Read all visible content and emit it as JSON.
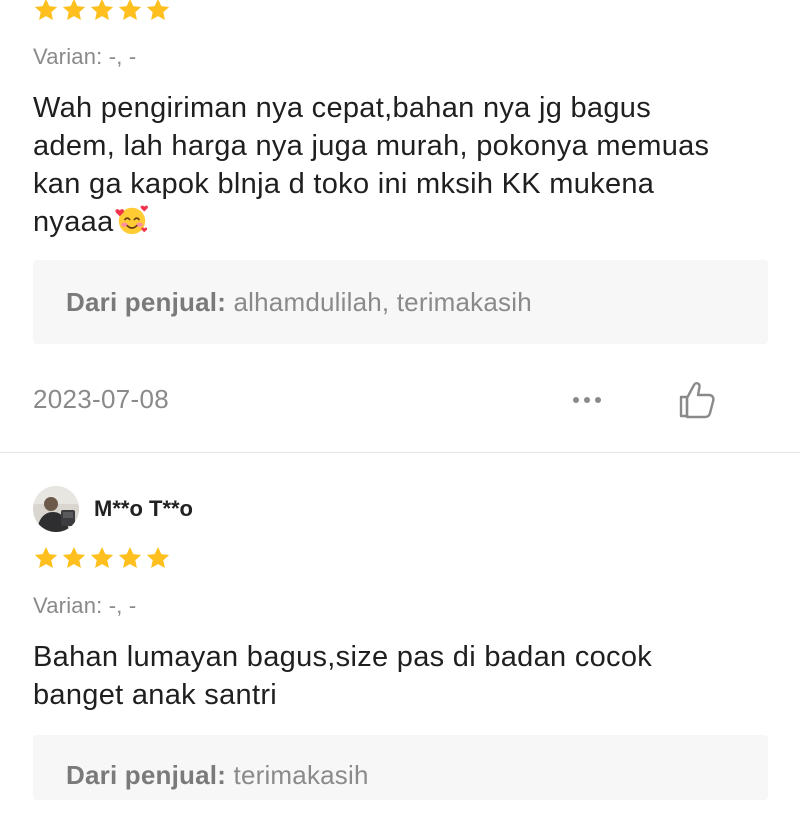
{
  "reviews": [
    {
      "rating": 5,
      "variant": "Varian: -, -",
      "comment_lines": [
        "Wah pengiriman nya cepat,bahan nya jg bagus",
        "adem, lah harga nya juga murah, pokonya memuas",
        "kan ga kapok blnja d toko ini mksih KK mukena",
        "nyaaa"
      ],
      "emoji": "smiling-face-with-hearts-icon",
      "seller_reply_label": "Dari penjual:",
      "seller_reply_text": "alhamdulilah,  terimakasih",
      "date": "2023-07-08"
    },
    {
      "username": "M**o T**o",
      "rating": 5,
      "variant": "Varian: -, -",
      "comment_lines": [
        "Bahan lumayan bagus,size pas di badan cocok",
        "banget anak santri"
      ],
      "seller_reply_label": "Dari penjual:",
      "seller_reply_text": "terimakasih"
    }
  ],
  "colors": {
    "star": "#FFC01F",
    "muted_text": "#8A8A8A",
    "reply_bg": "#F7F7F7",
    "divider": "#E6E6E6"
  },
  "icons": {
    "more": "more-options-icon",
    "like": "thumbs-up-icon",
    "star": "star-icon"
  }
}
